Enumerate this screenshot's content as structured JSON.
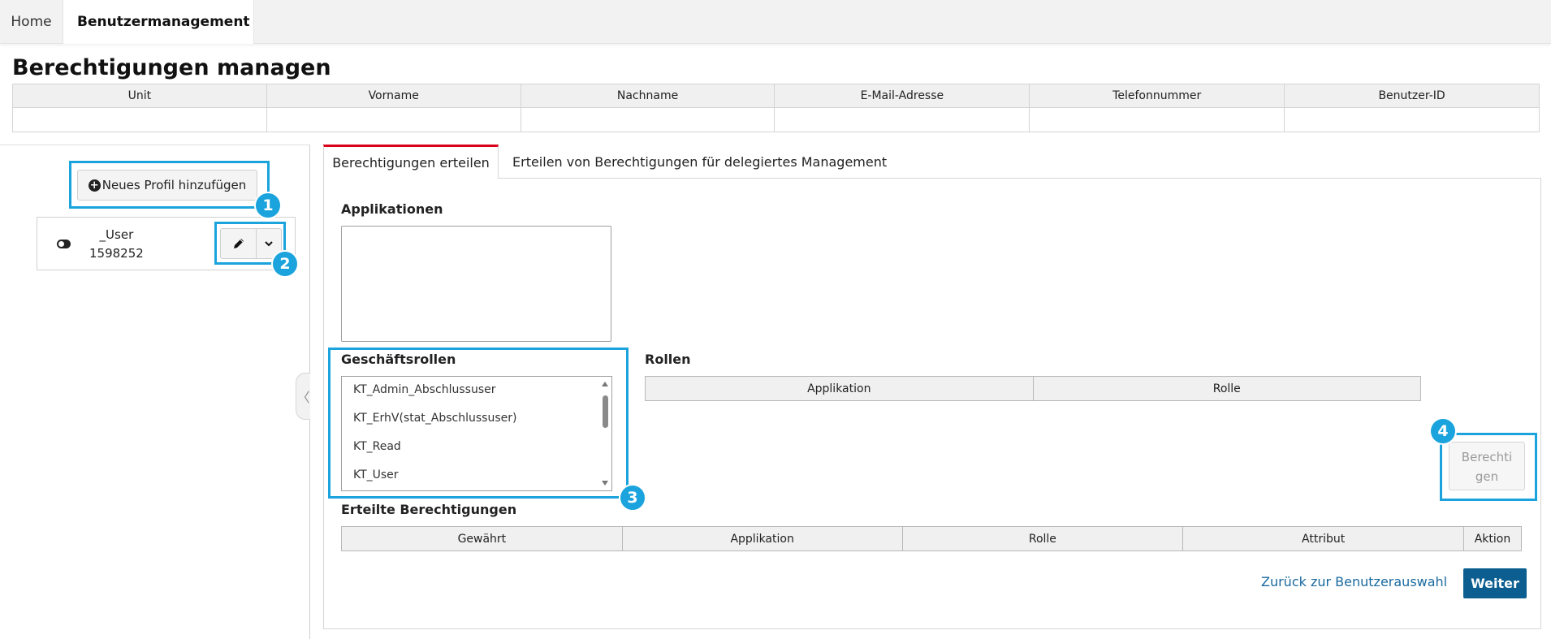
{
  "nav": {
    "home_label": "Home",
    "active_label": "Benutzermanagement"
  },
  "page": {
    "title": "Berechtigungen managen"
  },
  "user_table": {
    "columns": [
      "Unit",
      "Vorname",
      "Nachname",
      "E-Mail-Adresse",
      "Telefonnummer",
      "Benutzer-ID"
    ],
    "row": [
      "",
      "",
      "",
      "",
      "",
      ""
    ]
  },
  "left_panel": {
    "new_profile_label": "Neues Profil hinzufügen",
    "profile": {
      "line1": "_User",
      "line2": "1598252"
    },
    "collapse_glyph": "〈"
  },
  "tabs": [
    {
      "label": "Berechtigungen erteilen",
      "active": true
    },
    {
      "label": "Erteilen von Berechtigungen für delegiertes Management",
      "active": false
    }
  ],
  "sections": {
    "applications_label": "Applikationen",
    "business_roles_label": "Geschäftsrollen",
    "roles_label": "Rollen",
    "granted_label": "Erteilte Berechtigungen"
  },
  "business_roles": [
    "KT_Admin_Abschlussuser",
    "KT_ErhV(stat_Abschlussuser)",
    "KT_Read",
    "KT_User"
  ],
  "roles_table": {
    "columns": [
      "Applikation",
      "Rolle"
    ]
  },
  "granted_table": {
    "columns": [
      "Gewährt",
      "Applikation",
      "Rolle",
      "Attribut",
      "Aktion"
    ]
  },
  "actions": {
    "berechtigen_line1": "Berechti",
    "berechtigen_line2": "gen",
    "back_link": "Zurück zur Benutzerauswahl",
    "next_button": "Weiter"
  },
  "callouts": [
    "1",
    "2",
    "3",
    "4"
  ],
  "colors": {
    "accent_tab": "#d9001b",
    "callout": "#1aa3dc",
    "primary_button": "#0b5e8f",
    "link": "#1a6aa0"
  },
  "icons": {
    "plus": "plus-circle-icon",
    "toggle": "toggle-icon",
    "edit": "pencil-icon",
    "dropdown": "chevron-down-icon",
    "nav_chevron": "chevron-down-icon"
  }
}
